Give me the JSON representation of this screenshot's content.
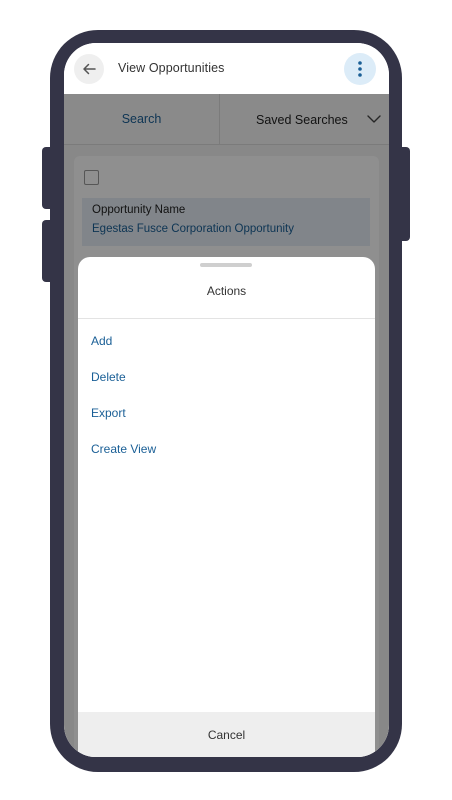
{
  "header": {
    "title": "View Opportunities",
    "back_icon": "arrow-left-icon",
    "menu_icon": "kebab-menu-icon"
  },
  "tabs": {
    "search_label": "Search",
    "saved_label": "Saved Searches"
  },
  "record": {
    "field_label": "Opportunity Name",
    "field_value": "Egestas Fusce Corporation Opportunity"
  },
  "action_sheet": {
    "title": "Actions",
    "items": [
      {
        "label": "Add"
      },
      {
        "label": "Delete"
      },
      {
        "label": "Export"
      },
      {
        "label": "Create View"
      }
    ],
    "cancel_label": "Cancel"
  },
  "colors": {
    "frame": "#343447",
    "link": "#1a5f96",
    "accent_bg": "#dcecf8"
  }
}
